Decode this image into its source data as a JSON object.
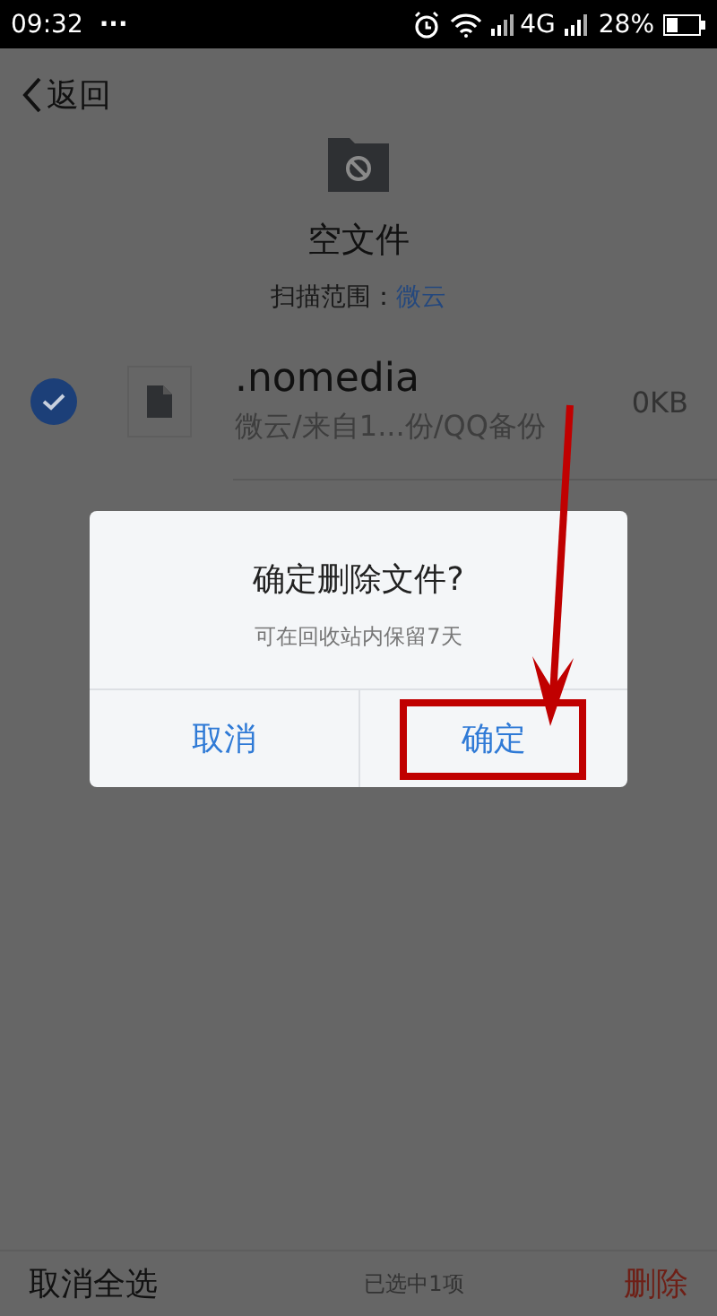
{
  "status_bar": {
    "time": "09:32",
    "more": "···",
    "network": "4G",
    "battery": "28%"
  },
  "header": {
    "back": "返回"
  },
  "summary": {
    "title": "空文件",
    "scope_label": "扫描范围：",
    "scope_value": "微云"
  },
  "files": [
    {
      "name": ".nomedia",
      "path": "微云/来自1...份/QQ备份",
      "size": "0KB",
      "checked": true
    }
  ],
  "dialog": {
    "title": "确定删除文件?",
    "message": "可在回收站内保留7天",
    "buttons": [
      {
        "label": "取消",
        "highlighted": false
      },
      {
        "label": "确定",
        "highlighted": true
      }
    ]
  },
  "bottom_bar": {
    "deselect": "取消全选",
    "count": "已选中1项",
    "delete": "删除"
  }
}
